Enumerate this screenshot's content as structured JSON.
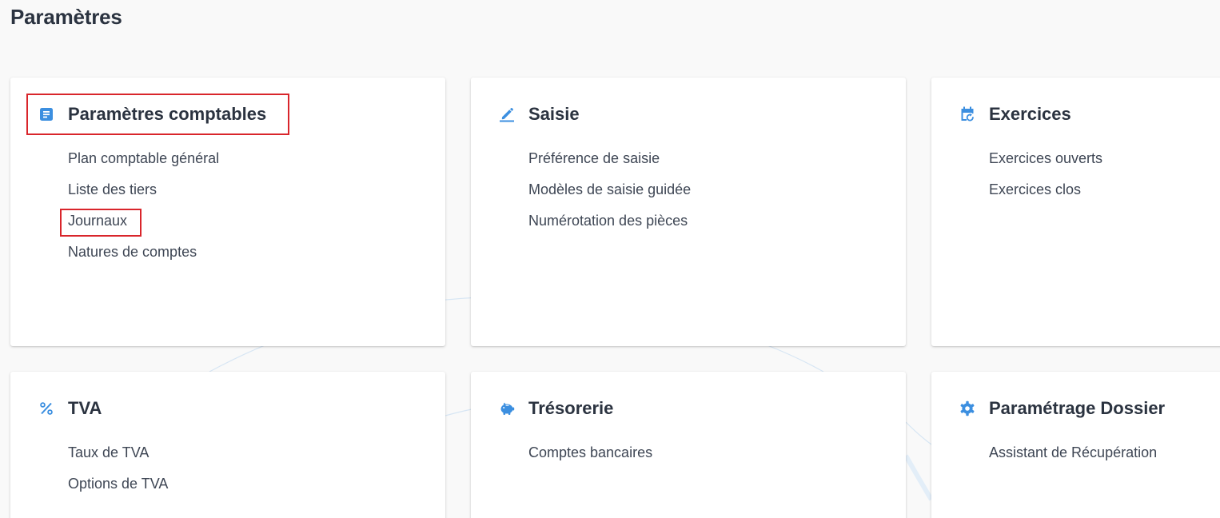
{
  "page_title": "Paramètres",
  "cards": [
    {
      "title": "Paramètres comptables",
      "icon": "ledger-icon",
      "links": [
        "Plan comptable général",
        "Liste des tiers",
        "Journaux",
        "Natures de comptes"
      ]
    },
    {
      "title": "Saisie",
      "icon": "pencil-icon",
      "links": [
        "Préférence de saisie",
        "Modèles de saisie guidée",
        "Numérotation des pièces"
      ]
    },
    {
      "title": "Exercices",
      "icon": "calendar-refresh-icon",
      "links": [
        "Exercices ouverts",
        "Exercices clos"
      ]
    },
    {
      "title": "TVA",
      "icon": "percent-icon",
      "links": [
        "Taux de TVA",
        "Options de TVA"
      ]
    },
    {
      "title": "Trésorerie",
      "icon": "piggy-bank-icon",
      "links": [
        "Comptes bancaires"
      ]
    },
    {
      "title": "Paramétrage Dossier",
      "icon": "gear-icon",
      "links": [
        "Assistant de Récupération"
      ]
    }
  ],
  "highlights": [
    "Paramètres comptables",
    "Journaux"
  ],
  "colors": {
    "accent": "#3c8fe0",
    "title_text": "#2b3340",
    "link_text": "#3e4654",
    "highlight": "#d9252b",
    "background": "#f9f9f9"
  }
}
